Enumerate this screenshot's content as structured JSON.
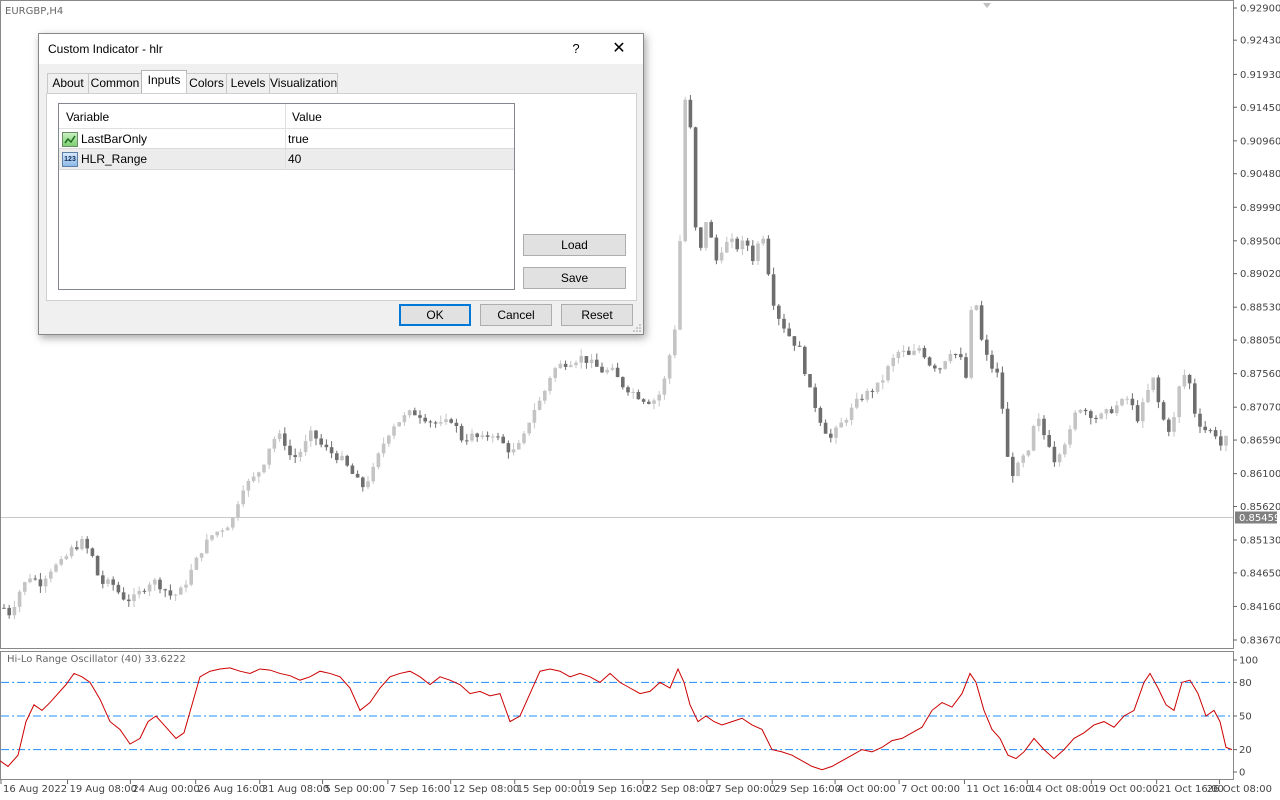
{
  "window": {
    "symbol": "EURGBP,H4"
  },
  "chart_data": {
    "type": "candlestick",
    "price": {
      "ylim": [
        0.8367,
        0.929
      ],
      "ticks": [
        "0.92900",
        "0.92430",
        "0.91930",
        "0.91450",
        "0.90960",
        "0.90480",
        "0.89990",
        "0.89500",
        "0.89020",
        "0.88530",
        "0.88050",
        "0.87560",
        "0.87070",
        "0.86590",
        "0.86100",
        "0.85620",
        "0.85130",
        "0.84650",
        "0.84160",
        "0.83670"
      ],
      "current_price": "0.85459",
      "close_path": [
        [
          0,
          0.842
        ],
        [
          10,
          0.8405
        ],
        [
          20,
          0.844
        ],
        [
          30,
          0.846
        ],
        [
          40,
          0.845
        ],
        [
          50,
          0.847
        ],
        [
          62,
          0.848
        ],
        [
          72,
          0.85
        ],
        [
          82,
          0.851
        ],
        [
          92,
          0.849
        ],
        [
          100,
          0.845
        ],
        [
          112,
          0.845
        ],
        [
          122,
          0.843
        ],
        [
          132,
          0.8425
        ],
        [
          142,
          0.844
        ],
        [
          152,
          0.8455
        ],
        [
          162,
          0.8445
        ],
        [
          172,
          0.843
        ],
        [
          182,
          0.844
        ],
        [
          192,
          0.847
        ],
        [
          202,
          0.85
        ],
        [
          212,
          0.852
        ],
        [
          222,
          0.853
        ],
        [
          232,
          0.854
        ],
        [
          242,
          0.859
        ],
        [
          252,
          0.86
        ],
        [
          262,
          0.862
        ],
        [
          272,
          0.866
        ],
        [
          282,
          0.8665
        ],
        [
          292,
          0.863
        ],
        [
          302,
          0.8645
        ],
        [
          312,
          0.867
        ],
        [
          322,
          0.865
        ],
        [
          332,
          0.864
        ],
        [
          342,
          0.863
        ],
        [
          352,
          0.861
        ],
        [
          362,
          0.859
        ],
        [
          372,
          0.861
        ],
        [
          382,
          0.865
        ],
        [
          392,
          0.868
        ],
        [
          402,
          0.869
        ],
        [
          412,
          0.87
        ],
        [
          422,
          0.8695
        ],
        [
          432,
          0.8685
        ],
        [
          442,
          0.868
        ],
        [
          452,
          0.869
        ],
        [
          462,
          0.866
        ],
        [
          472,
          0.8665
        ],
        [
          482,
          0.866
        ],
        [
          492,
          0.867
        ],
        [
          502,
          0.8655
        ],
        [
          512,
          0.864
        ],
        [
          522,
          0.8655
        ],
        [
          532,
          0.87
        ],
        [
          542,
          0.872
        ],
        [
          552,
          0.876
        ],
        [
          562,
          0.877
        ],
        [
          572,
          0.8775
        ],
        [
          582,
          0.878
        ],
        [
          592,
          0.877
        ],
        [
          602,
          0.876
        ],
        [
          612,
          0.876
        ],
        [
          622,
          0.874
        ],
        [
          632,
          0.873
        ],
        [
          642,
          0.872
        ],
        [
          652,
          0.8715
        ],
        [
          662,
          0.873
        ],
        [
          672,
          0.88
        ],
        [
          678,
          0.885
        ],
        [
          684,
          0.915
        ],
        [
          688,
          0.917
        ],
        [
          693,
          0.905
        ],
        [
          698,
          0.889
        ],
        [
          704,
          0.899
        ],
        [
          710,
          0.896
        ],
        [
          716,
          0.892
        ],
        [
          722,
          0.894
        ],
        [
          730,
          0.895
        ],
        [
          738,
          0.894
        ],
        [
          746,
          0.895
        ],
        [
          754,
          0.892
        ],
        [
          762,
          0.897
        ],
        [
          770,
          0.889
        ],
        [
          775,
          0.885
        ],
        [
          782,
          0.883
        ],
        [
          790,
          0.881
        ],
        [
          800,
          0.879
        ],
        [
          810,
          0.873
        ],
        [
          820,
          0.869
        ],
        [
          830,
          0.866
        ],
        [
          840,
          0.868
        ],
        [
          850,
          0.87
        ],
        [
          860,
          0.872
        ],
        [
          870,
          0.873
        ],
        [
          880,
          0.874
        ],
        [
          890,
          0.877
        ],
        [
          900,
          0.879
        ],
        [
          910,
          0.878
        ],
        [
          920,
          0.8795
        ],
        [
          930,
          0.877
        ],
        [
          940,
          0.8765
        ],
        [
          950,
          0.879
        ],
        [
          960,
          0.878
        ],
        [
          966,
          0.875
        ],
        [
          970,
          0.884
        ],
        [
          976,
          0.886
        ],
        [
          982,
          0.88
        ],
        [
          988,
          0.8775
        ],
        [
          994,
          0.876
        ],
        [
          1000,
          0.875
        ],
        [
          1006,
          0.864
        ],
        [
          1012,
          0.861
        ],
        [
          1018,
          0.862
        ],
        [
          1024,
          0.8635
        ],
        [
          1030,
          0.864
        ],
        [
          1036,
          0.87
        ],
        [
          1042,
          0.867
        ],
        [
          1048,
          0.866
        ],
        [
          1054,
          0.863
        ],
        [
          1062,
          0.865
        ],
        [
          1070,
          0.867
        ],
        [
          1078,
          0.871
        ],
        [
          1088,
          0.87
        ],
        [
          1098,
          0.869
        ],
        [
          1108,
          0.87
        ],
        [
          1118,
          0.871
        ],
        [
          1128,
          0.872
        ],
        [
          1138,
          0.869
        ],
        [
          1148,
          0.873
        ],
        [
          1154,
          0.875
        ],
        [
          1160,
          0.87
        ],
        [
          1166,
          0.868
        ],
        [
          1172,
          0.867
        ],
        [
          1178,
          0.873
        ],
        [
          1184,
          0.8755
        ],
        [
          1190,
          0.874
        ],
        [
          1196,
          0.869
        ],
        [
          1202,
          0.868
        ],
        [
          1208,
          0.867
        ],
        [
          1214,
          0.8675
        ],
        [
          1220,
          0.865
        ],
        [
          1226,
          0.866
        ],
        [
          1232,
          0.867
        ]
      ],
      "x_labels": [
        {
          "label": "16 Aug 2022",
          "pos": 0.0
        },
        {
          "label": "19 Aug 08:00",
          "pos": 0.054
        },
        {
          "label": "24 Aug 00:00",
          "pos": 0.105
        },
        {
          "label": "26 Aug 16:00",
          "pos": 0.158
        },
        {
          "label": "31 Aug 08:00",
          "pos": 0.21
        },
        {
          "label": "5 Sep 00:00",
          "pos": 0.261
        },
        {
          "label": "7 Sep 16:00",
          "pos": 0.314
        },
        {
          "label": "12 Sep 08:00",
          "pos": 0.365
        },
        {
          "label": "15 Sep 00:00",
          "pos": 0.417
        },
        {
          "label": "19 Sep 16:00",
          "pos": 0.47
        },
        {
          "label": "22 Sep 08:00",
          "pos": 0.521
        },
        {
          "label": "27 Sep 00:00",
          "pos": 0.573
        },
        {
          "label": "29 Sep 16:00",
          "pos": 0.626
        },
        {
          "label": "4 Oct 00:00",
          "pos": 0.677
        },
        {
          "label": "7 Oct 00:00",
          "pos": 0.729
        },
        {
          "label": "11 Oct 16:00",
          "pos": 0.782
        },
        {
          "label": "14 Oct 08:00",
          "pos": 0.833
        },
        {
          "label": "19 Oct 00:00",
          "pos": 0.885
        },
        {
          "label": "21 Oct 16:00",
          "pos": 0.938
        },
        {
          "label": "26 Oct 08:00",
          "pos": 0.989
        }
      ]
    },
    "oscillator": {
      "title": "Hi-Lo Range Oscillator (40) 33.6222",
      "ylim": [
        0,
        100
      ],
      "levels": [
        20,
        50,
        80
      ],
      "ticks": [
        "100",
        "80",
        "50",
        "20",
        "0"
      ],
      "color": "#cc0000",
      "level_color": "#1e90ff",
      "values": [
        [
          0,
          10
        ],
        [
          8,
          5
        ],
        [
          18,
          15
        ],
        [
          26,
          45
        ],
        [
          34,
          60
        ],
        [
          42,
          55
        ],
        [
          50,
          62
        ],
        [
          58,
          70
        ],
        [
          66,
          78
        ],
        [
          74,
          88
        ],
        [
          82,
          85
        ],
        [
          90,
          80
        ],
        [
          100,
          65
        ],
        [
          110,
          45
        ],
        [
          120,
          38
        ],
        [
          130,
          25
        ],
        [
          140,
          30
        ],
        [
          148,
          45
        ],
        [
          156,
          50
        ],
        [
          166,
          40
        ],
        [
          176,
          30
        ],
        [
          184,
          35
        ],
        [
          192,
          60
        ],
        [
          200,
          85
        ],
        [
          210,
          90
        ],
        [
          220,
          92
        ],
        [
          230,
          93
        ],
        [
          240,
          90
        ],
        [
          250,
          88
        ],
        [
          260,
          92
        ],
        [
          270,
          91
        ],
        [
          280,
          88
        ],
        [
          290,
          86
        ],
        [
          300,
          82
        ],
        [
          310,
          85
        ],
        [
          320,
          90
        ],
        [
          330,
          88
        ],
        [
          340,
          85
        ],
        [
          350,
          75
        ],
        [
          360,
          55
        ],
        [
          370,
          62
        ],
        [
          380,
          75
        ],
        [
          390,
          85
        ],
        [
          400,
          88
        ],
        [
          410,
          90
        ],
        [
          420,
          85
        ],
        [
          430,
          78
        ],
        [
          440,
          85
        ],
        [
          450,
          82
        ],
        [
          460,
          78
        ],
        [
          470,
          70
        ],
        [
          480,
          72
        ],
        [
          490,
          68
        ],
        [
          500,
          70
        ],
        [
          510,
          45
        ],
        [
          520,
          50
        ],
        [
          530,
          70
        ],
        [
          540,
          90
        ],
        [
          550,
          92
        ],
        [
          560,
          90
        ],
        [
          570,
          85
        ],
        [
          580,
          88
        ],
        [
          590,
          85
        ],
        [
          600,
          80
        ],
        [
          610,
          88
        ],
        [
          620,
          80
        ],
        [
          630,
          75
        ],
        [
          640,
          70
        ],
        [
          650,
          72
        ],
        [
          660,
          80
        ],
        [
          670,
          75
        ],
        [
          678,
          92
        ],
        [
          684,
          80
        ],
        [
          690,
          60
        ],
        [
          698,
          45
        ],
        [
          706,
          50
        ],
        [
          714,
          45
        ],
        [
          722,
          42
        ],
        [
          732,
          45
        ],
        [
          742,
          48
        ],
        [
          752,
          42
        ],
        [
          762,
          38
        ],
        [
          772,
          20
        ],
        [
          782,
          18
        ],
        [
          792,
          15
        ],
        [
          802,
          10
        ],
        [
          812,
          5
        ],
        [
          822,
          2
        ],
        [
          832,
          5
        ],
        [
          842,
          10
        ],
        [
          852,
          15
        ],
        [
          862,
          20
        ],
        [
          872,
          18
        ],
        [
          882,
          22
        ],
        [
          892,
          28
        ],
        [
          902,
          30
        ],
        [
          912,
          35
        ],
        [
          922,
          40
        ],
        [
          932,
          55
        ],
        [
          942,
          62
        ],
        [
          952,
          58
        ],
        [
          962,
          70
        ],
        [
          970,
          88
        ],
        [
          976,
          80
        ],
        [
          984,
          55
        ],
        [
          992,
          38
        ],
        [
          1000,
          30
        ],
        [
          1008,
          15
        ],
        [
          1016,
          12
        ],
        [
          1024,
          18
        ],
        [
          1034,
          30
        ],
        [
          1044,
          20
        ],
        [
          1054,
          12
        ],
        [
          1064,
          20
        ],
        [
          1074,
          30
        ],
        [
          1084,
          35
        ],
        [
          1094,
          42
        ],
        [
          1104,
          45
        ],
        [
          1114,
          40
        ],
        [
          1124,
          50
        ],
        [
          1134,
          55
        ],
        [
          1144,
          80
        ],
        [
          1150,
          88
        ],
        [
          1158,
          75
        ],
        [
          1166,
          60
        ],
        [
          1174,
          55
        ],
        [
          1182,
          80
        ],
        [
          1190,
          82
        ],
        [
          1198,
          70
        ],
        [
          1206,
          50
        ],
        [
          1214,
          55
        ],
        [
          1220,
          45
        ],
        [
          1226,
          22
        ],
        [
          1232,
          20
        ]
      ]
    }
  },
  "dialog": {
    "title": "Custom Indicator - hlr",
    "help_label": "?",
    "close_label": "✕",
    "tabs": [
      {
        "label": "About",
        "active": false
      },
      {
        "label": "Common",
        "active": false
      },
      {
        "label": "Inputs",
        "active": true
      },
      {
        "label": "Colors",
        "active": false
      },
      {
        "label": "Levels",
        "active": false
      },
      {
        "label": "Visualization",
        "active": false
      }
    ],
    "grid": {
      "header_variable": "Variable",
      "header_value": "Value",
      "rows": [
        {
          "name": "LastBarOnly",
          "value": "true",
          "icon": "boolean-icon"
        },
        {
          "name": "HLR_Range",
          "value": "40",
          "icon": "integer-icon",
          "icon_text": "123"
        }
      ]
    },
    "load_label": "Load",
    "save_label": "Save",
    "ok_label": "OK",
    "cancel_label": "Cancel",
    "reset_label": "Reset"
  }
}
